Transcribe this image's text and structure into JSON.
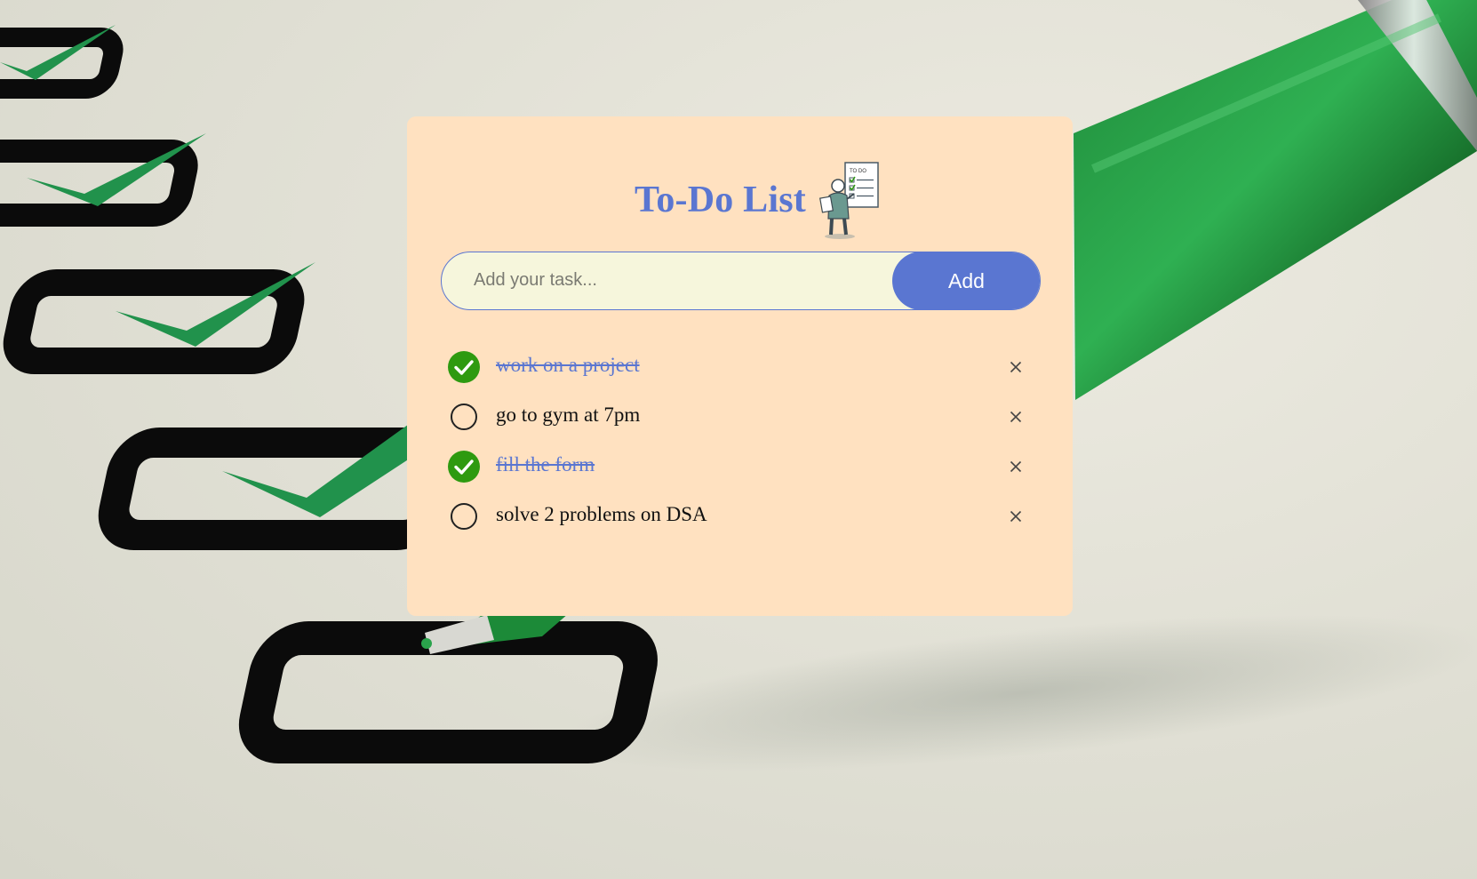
{
  "app": {
    "title": "To-Do List",
    "title_icon": "todo-list-person-icon"
  },
  "input": {
    "placeholder": "Add your task...",
    "value": ""
  },
  "add_button": {
    "label": "Add"
  },
  "tasks": [
    {
      "text": "work on a project",
      "completed": true,
      "remove_icon": "close-icon"
    },
    {
      "text": "go to gym at 7pm",
      "completed": false,
      "remove_icon": "close-icon"
    },
    {
      "text": "fill the form",
      "completed": true,
      "remove_icon": "close-icon"
    },
    {
      "text": "solve 2 problems on DSA",
      "completed": false,
      "remove_icon": "close-icon"
    }
  ],
  "colors": {
    "accent": "#5a76d1",
    "card_background": "#ffe1c0",
    "input_background": "#f6f6dc",
    "check_green": "#2e9a10"
  }
}
